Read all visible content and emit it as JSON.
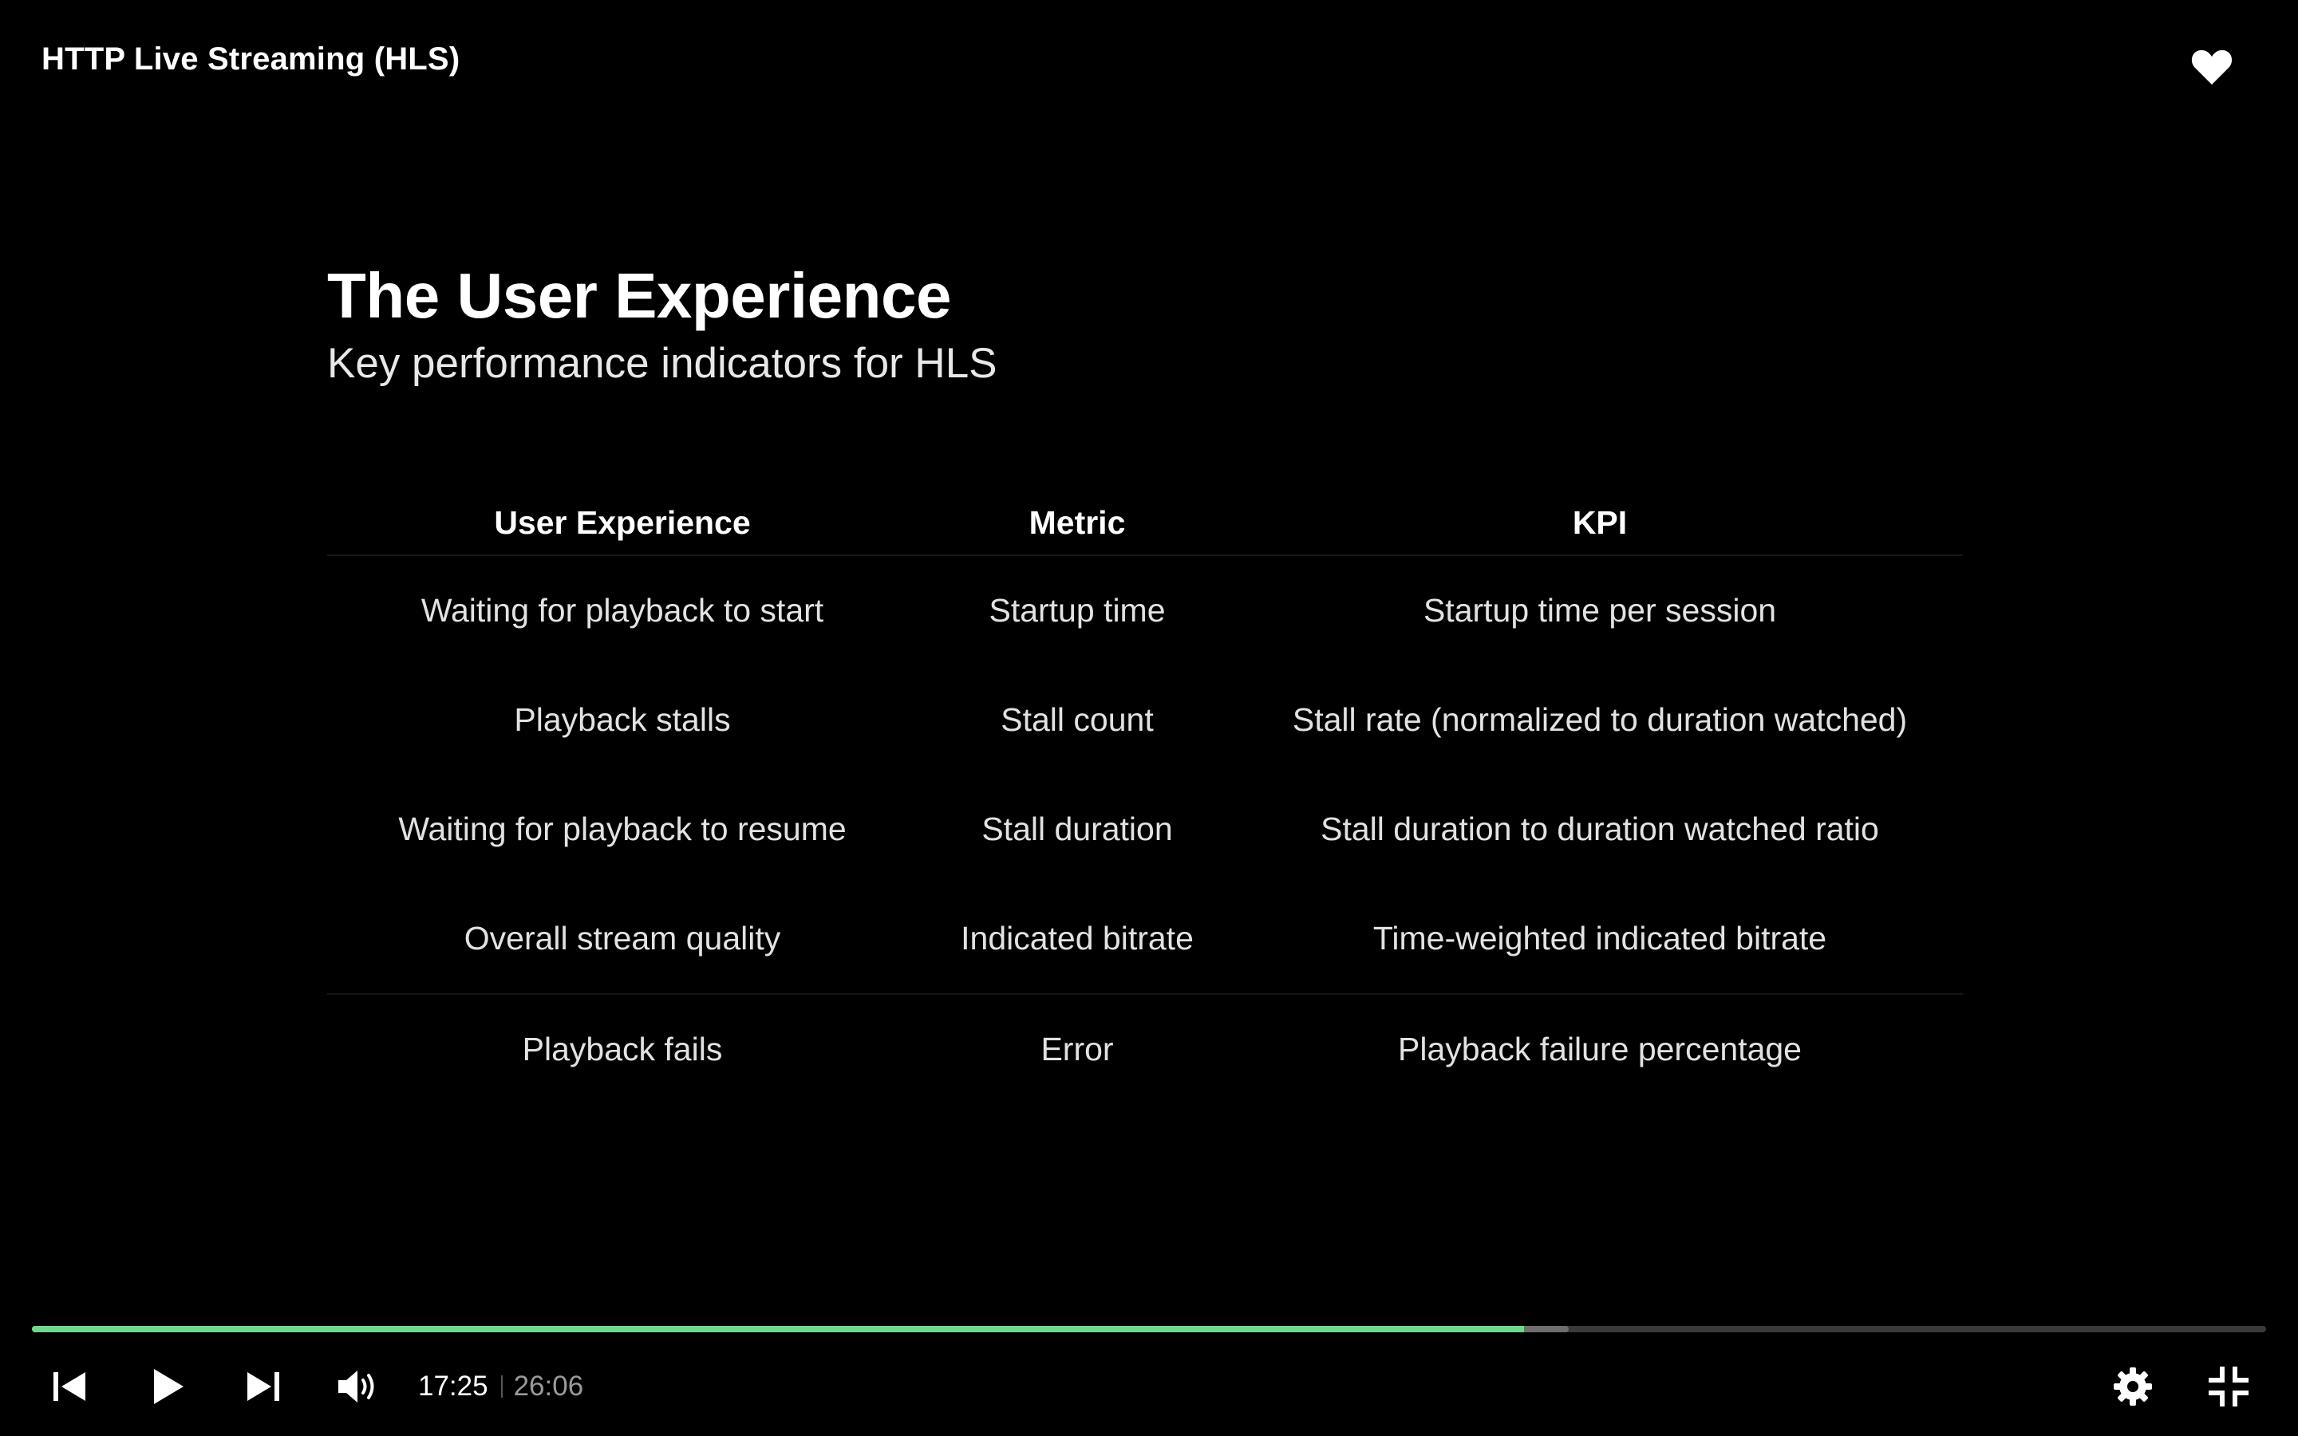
{
  "player": {
    "title": "HTTP Live Streaming (HLS)",
    "favorite_icon": "heart-icon",
    "accent_color": "#6fd88a"
  },
  "slide": {
    "title": "The User Experience",
    "subtitle": "Key performance indicators for HLS",
    "table": {
      "headers": [
        "User Experience",
        "Metric",
        "KPI"
      ],
      "rows": [
        [
          "Waiting for playback to start",
          "Startup time",
          "Startup time per session"
        ],
        [
          "Playback stalls",
          "Stall count",
          "Stall rate (normalized to duration watched)"
        ],
        [
          "Waiting for playback to resume",
          "Stall duration",
          "Stall duration to duration watched ratio"
        ],
        [
          "Overall stream quality",
          "Indicated bitrate",
          "Time-weighted indicated bitrate"
        ],
        [
          "Playback fails",
          "Error",
          "Playback failure percentage"
        ]
      ]
    }
  },
  "controls": {
    "current_time": "17:25",
    "duration": "26:06",
    "progress_fraction": 0.668,
    "buffered_fraction": 0.688,
    "icons": {
      "previous": "skip-previous-icon",
      "play": "play-icon",
      "next": "skip-next-icon",
      "volume": "volume-icon",
      "settings": "gear-icon",
      "exit_fullscreen": "exit-fullscreen-icon"
    }
  }
}
